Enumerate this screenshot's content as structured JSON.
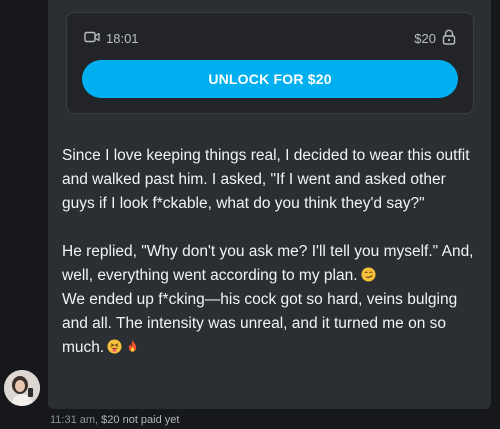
{
  "locked_media": {
    "duration": "18:01",
    "price": "$20",
    "unlock_label": "UNLOCK FOR $20",
    "icons": [
      "video-icon",
      "lock-icon"
    ]
  },
  "message": {
    "paragraph_1": "Since I love keeping things real, I decided to wear this outfit and walked past him. I asked, \"If I went and asked other guys if I look f*ckable, what do you think they'd say?\"",
    "paragraph_2": "He replied, \"Why don't you ask me? I'll tell you myself.\" And, well, everything went according to my plan.",
    "paragraph_3": "We ended up f*cking—his cock got so hard, veins bulging and all. The intensity was unreal, and it turned me on so much."
  },
  "meta": {
    "time": "11:31 am,",
    "status": "$20 not paid yet"
  },
  "colors": {
    "accent": "#00aff0",
    "bubble": "#2b2e33",
    "background": "#16181b"
  }
}
